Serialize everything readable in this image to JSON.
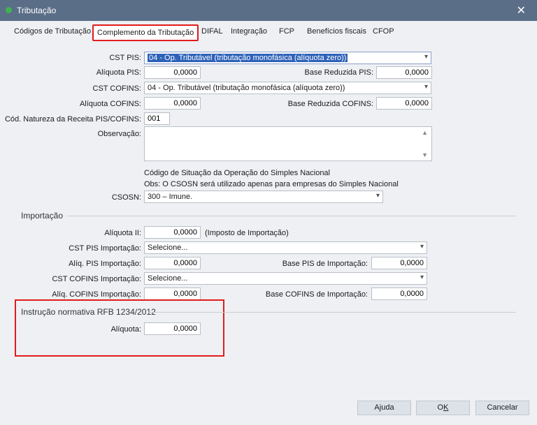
{
  "window": {
    "title": "Tributação",
    "close": "✕"
  },
  "tabs": [
    "Códigos de Tributação",
    "Complemento da Tributação",
    "DIFAL",
    "Integração",
    "FCP",
    "Benefícios fiscais",
    "CFOP"
  ],
  "pis": {
    "cst_label": "CST PIS:",
    "cst_value": "04 - Op. Tributável (tributação monofásica (alíquota zero))",
    "aliq_label": "Alíquota PIS:",
    "aliq_value": "0,0000",
    "base_label": "Base Reduzida PIS:",
    "base_value": "0,0000"
  },
  "cofins": {
    "cst_label": "CST COFINS:",
    "cst_value": "04 - Op. Tributável (tributação monofásica (alíquota zero))",
    "aliq_label": "Alíquota COFINS:",
    "aliq_value": "0,0000",
    "base_label": "Base Reduzida COFINS:",
    "base_value": "0,0000"
  },
  "natureza": {
    "label": "Cód. Natureza da Receita PIS/COFINS:",
    "value": "001"
  },
  "observacao": {
    "label": "Observação:"
  },
  "simples": {
    "info1": "Código de Situação da Operação do Simples Nacional",
    "info2": "Obs: O CSOSN será utilizado apenas para empresas do Simples Nacional",
    "label": "CSOSN:",
    "value": "300 – Imune."
  },
  "importacao": {
    "title": "Importação",
    "aliq_ii_label": "Alíquota II:",
    "aliq_ii_value": "0,0000",
    "aliq_ii_note": "(Imposto de Importação)",
    "cst_pis_label": "CST PIS Importação:",
    "cst_pis_value": "Selecione...",
    "aliq_pis_label": "Alíq. PIS Importação:",
    "aliq_pis_value": "0,0000",
    "base_pis_label": "Base PIS de Importação:",
    "base_pis_value": "0,0000",
    "cst_cofins_label": "CST COFINS Importação:",
    "cst_cofins_value": "Selecione...",
    "aliq_cofins_label": "Alíq. COFINS Importação:",
    "aliq_cofins_value": "0,0000",
    "base_cofins_label": "Base COFINS de Importação:",
    "base_cofins_value": "0,0000"
  },
  "instrucao": {
    "title": "Instrução normativa RFB 1234/2012",
    "aliq_label": "Alíquota:",
    "aliq_value": "0,0000"
  },
  "buttons": {
    "ajuda": "Ajuda",
    "ok_prefix": "O",
    "ok_underlined": "K",
    "cancelar": "Cancelar"
  },
  "colors": {
    "titlebar": "#5b6e88",
    "highlight": "#e11c1c",
    "selection": "#2e62b8"
  }
}
